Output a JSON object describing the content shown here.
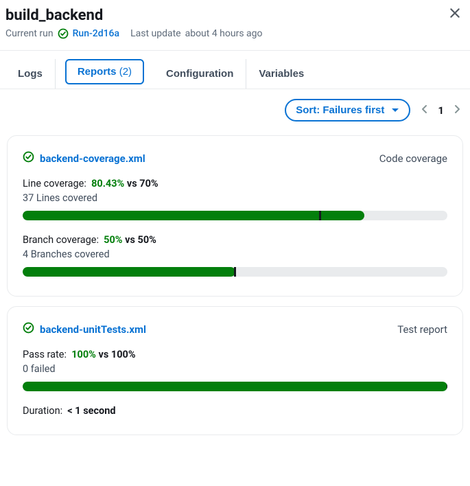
{
  "header": {
    "title": "build_backend",
    "currentRunLabel": "Current run",
    "runId": "Run-2d16a",
    "lastUpdateLabel": "Last update",
    "lastUpdateValue": "about 4 hours ago"
  },
  "tabs": {
    "logs": "Logs",
    "reports": "Reports",
    "reportsCount": "(2)",
    "configuration": "Configuration",
    "variables": "Variables"
  },
  "toolbar": {
    "sortLabel": "Sort: Failures first",
    "pageNumber": "1"
  },
  "cards": [
    {
      "title": "backend-coverage.xml",
      "type": "Code coverage",
      "metrics": [
        {
          "label": "Line coverage:",
          "value": "80.43%",
          "vs": "vs 70%",
          "sub": "37 Lines covered",
          "fillPercent": 80.43,
          "markerPercent": 70
        },
        {
          "label": "Branch coverage:",
          "value": "50%",
          "vs": "vs 50%",
          "sub": "4 Branches covered",
          "fillPercent": 50,
          "markerPercent": 50
        }
      ]
    },
    {
      "title": "backend-unitTests.xml",
      "type": "Test report",
      "metrics": [
        {
          "label": "Pass rate:",
          "value": "100%",
          "vs": "vs 100%",
          "sub": "0 failed",
          "fillPercent": 100,
          "markerPercent": 100
        }
      ],
      "durationLabel": "Duration:",
      "durationValue": "< 1 second"
    }
  ]
}
